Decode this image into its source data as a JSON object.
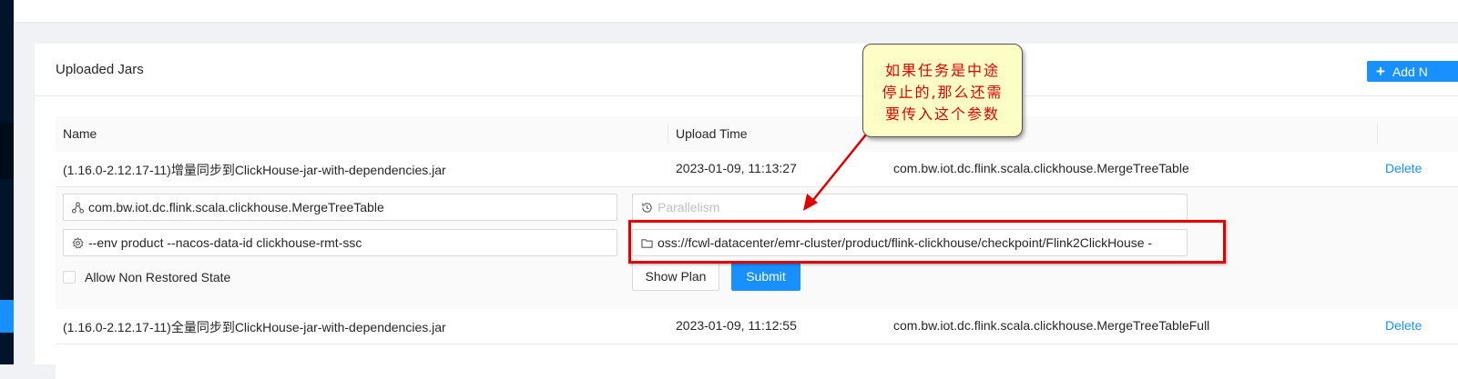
{
  "card": {
    "title": "Uploaded Jars",
    "add_button_label": "Add N"
  },
  "table": {
    "columns": [
      "Name",
      "Upload Time"
    ],
    "rows": [
      {
        "name": "(1.16.0-2.12.17-11)增量同步到ClickHouse-jar-with-dependencies.jar",
        "upload_time": "2023-01-09, 11:13:27",
        "entry_class": "com.bw.iot.dc.flink.scala.clickhouse.MergeTreeTable",
        "action": "Delete"
      },
      {
        "name": "(1.16.0-2.12.17-11)全量同步到ClickHouse-jar-with-dependencies.jar",
        "upload_time": "2023-01-09, 11:12:55",
        "entry_class": "com.bw.iot.dc.flink.scala.clickhouse.MergeTreeTableFull",
        "action": "Delete"
      }
    ]
  },
  "submit_form": {
    "entry_class_value": "com.bw.iot.dc.flink.scala.clickhouse.MergeTreeTable",
    "parallelism_placeholder": "Parallelism",
    "program_args_value": "--env product --nacos-data-id clickhouse-rmt-ssc",
    "savepoint_path_value": "oss://fcwl-datacenter/emr-cluster/product/flink-clickhouse/checkpoint/Flink2ClickHouse -",
    "allow_non_restored_label": "Allow Non Restored State",
    "allow_non_restored_checked": false,
    "show_plan_label": "Show Plan",
    "submit_label": "Submit"
  },
  "annotation": {
    "lines": [
      "如果任务是中途",
      "停止的,那么还需",
      "要传入这个参数"
    ],
    "color": "#e00000",
    "background": "#fdfdc6"
  },
  "colors": {
    "primary": "#1890ff",
    "sidebar": "#001529"
  },
  "icons": {
    "entry_class": "entry-class-icon",
    "parallelism": "parallelism-icon",
    "program_args": "gear-icon",
    "savepoint_path": "folder-icon",
    "add": "plus-icon"
  }
}
